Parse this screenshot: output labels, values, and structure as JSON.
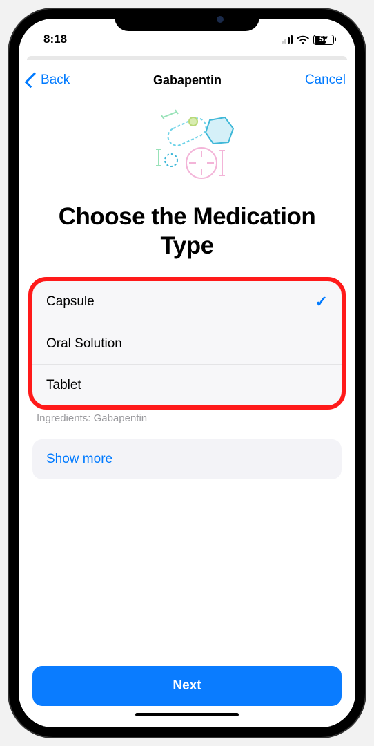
{
  "status": {
    "time": "8:18",
    "battery_pct": "57"
  },
  "nav": {
    "back_label": "Back",
    "title": "Gabapentin",
    "cancel_label": "Cancel"
  },
  "page": {
    "heading": "Choose the Medication Type",
    "types": [
      {
        "label": "Capsule",
        "selected": true
      },
      {
        "label": "Oral Solution",
        "selected": false
      },
      {
        "label": "Tablet",
        "selected": false
      }
    ],
    "ingredients_label": "Ingredients:",
    "ingredients_value": "Gabapentin",
    "show_more_label": "Show more",
    "next_label": "Next"
  },
  "colors": {
    "link": "#007aff",
    "primary_button": "#0a7cff",
    "highlight": "#ff1a1a"
  }
}
